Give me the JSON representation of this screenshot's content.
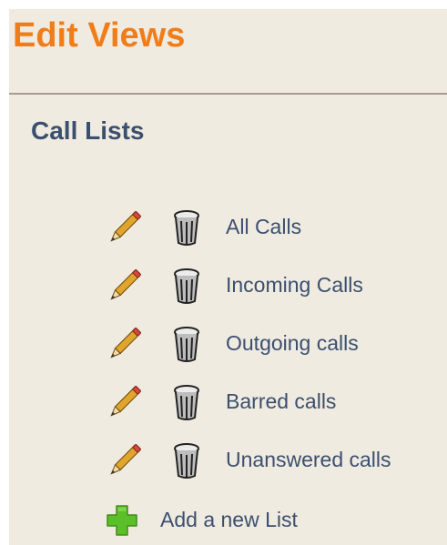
{
  "header": {
    "title": "Edit Views"
  },
  "section": {
    "title": "Call Lists"
  },
  "lists": [
    {
      "label": "All Calls"
    },
    {
      "label": "Incoming Calls"
    },
    {
      "label": "Outgoing calls"
    },
    {
      "label": "Barred calls"
    },
    {
      "label": "Unanswered calls"
    }
  ],
  "add": {
    "label": "Add a new List"
  },
  "icons": {
    "edit": "pencil-icon",
    "delete": "trash-icon",
    "add": "plus-icon"
  },
  "colors": {
    "title": "#f07d1a",
    "text": "#3b4f6e",
    "background": "#f0ebe0",
    "add_icon": "#5cbf2a"
  }
}
